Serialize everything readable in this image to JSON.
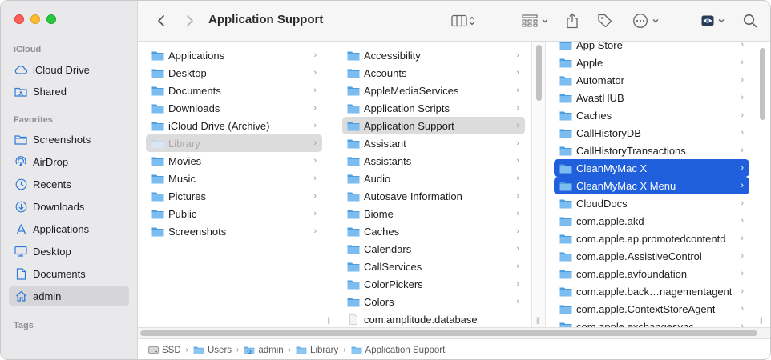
{
  "window": {
    "title": "Application Support"
  },
  "colors": {
    "selection_blue": "#2060dd",
    "folder_blue": "#5fa8e3",
    "sidebar_icon": "#2f7bd8"
  },
  "sidebar": {
    "sections": [
      {
        "label": "iCloud"
      },
      {
        "label": "Favorites"
      },
      {
        "label": "Tags"
      }
    ],
    "icloud": [
      {
        "label": "iCloud Drive",
        "icon": "cloud-icon"
      },
      {
        "label": "Shared",
        "icon": "shared-folder-icon"
      }
    ],
    "favorites": [
      {
        "label": "Screenshots",
        "icon": "folder-icon"
      },
      {
        "label": "AirDrop",
        "icon": "airdrop-icon"
      },
      {
        "label": "Recents",
        "icon": "clock-icon"
      },
      {
        "label": "Downloads",
        "icon": "download-icon"
      },
      {
        "label": "Applications",
        "icon": "applications-icon"
      },
      {
        "label": "Desktop",
        "icon": "desktop-icon"
      },
      {
        "label": "Documents",
        "icon": "document-icon"
      },
      {
        "label": "admin",
        "icon": "home-icon",
        "selected": true
      }
    ]
  },
  "toolbar": {
    "back": "back-icon",
    "forward": "forward-icon",
    "view": "columns-view-icon",
    "group": "group-icon",
    "share": "share-icon",
    "tag": "tag-icon",
    "more": "ellipsis-icon",
    "preview": "eye-icon",
    "search": "search-icon"
  },
  "columns": {
    "col1": [
      {
        "label": "Applications"
      },
      {
        "label": "Desktop"
      },
      {
        "label": "Documents"
      },
      {
        "label": "Downloads"
      },
      {
        "label": "iCloud Drive (Archive)"
      },
      {
        "label": "Library",
        "state": "dim-selected"
      },
      {
        "label": "Movies"
      },
      {
        "label": "Music"
      },
      {
        "label": "Pictures"
      },
      {
        "label": "Public"
      },
      {
        "label": "Screenshots"
      }
    ],
    "col2": [
      {
        "label": "Accessibility"
      },
      {
        "label": "Accounts"
      },
      {
        "label": "AppleMediaServices"
      },
      {
        "label": "Application Scripts"
      },
      {
        "label": "Application Support",
        "state": "selected-gray"
      },
      {
        "label": "Assistant"
      },
      {
        "label": "Assistants"
      },
      {
        "label": "Audio"
      },
      {
        "label": "Autosave Information"
      },
      {
        "label": "Biome"
      },
      {
        "label": "Caches"
      },
      {
        "label": "Calendars"
      },
      {
        "label": "CallServices"
      },
      {
        "label": "ColorPickers"
      },
      {
        "label": "Colors"
      },
      {
        "label": "com.amplitude.database",
        "kind": "file"
      }
    ],
    "col3": [
      {
        "label": "App Store"
      },
      {
        "label": "Apple"
      },
      {
        "label": "Automator"
      },
      {
        "label": "AvastHUB"
      },
      {
        "label": "Caches"
      },
      {
        "label": "CallHistoryDB"
      },
      {
        "label": "CallHistoryTransactions"
      },
      {
        "label": "CleanMyMac X",
        "state": "selected-blue"
      },
      {
        "label": "CleanMyMac X Menu",
        "state": "selected-blue"
      },
      {
        "label": "CloudDocs"
      },
      {
        "label": "com.apple.akd"
      },
      {
        "label": "com.apple.ap.promotedcontentd"
      },
      {
        "label": "com.apple.AssistiveControl"
      },
      {
        "label": "com.apple.avfoundation"
      },
      {
        "label": "com.apple.back…nagementagent"
      },
      {
        "label": "com.apple.ContextStoreAgent"
      },
      {
        "label": "com.apple.exchangesync"
      }
    ]
  },
  "pathbar": [
    {
      "label": "SSD",
      "icon": "disk-icon"
    },
    {
      "label": "Users",
      "icon": "folder-icon"
    },
    {
      "label": "admin",
      "icon": "home-folder-icon"
    },
    {
      "label": "Library",
      "icon": "folder-icon"
    },
    {
      "label": "Application Support",
      "icon": "folder-icon"
    }
  ]
}
